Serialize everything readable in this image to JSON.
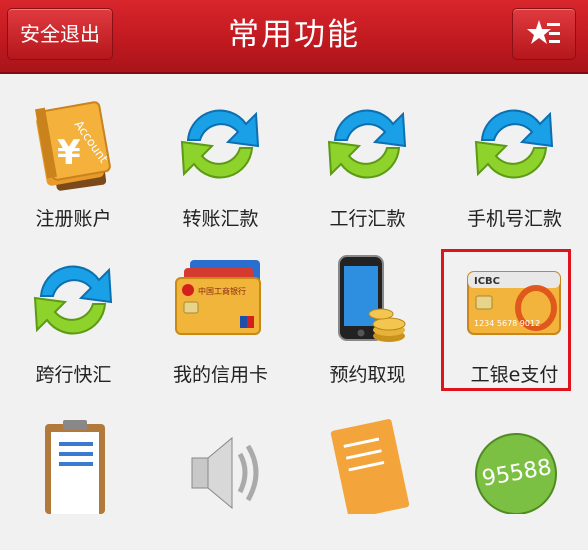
{
  "header": {
    "logout_label": "安全退出",
    "title": "常用功能",
    "menu_icon": "star-list-icon"
  },
  "grid": [
    {
      "label": "注册账户",
      "icon": "account-book-icon"
    },
    {
      "label": "转账汇款",
      "icon": "refresh-arrows-icon"
    },
    {
      "label": "工行汇款",
      "icon": "refresh-arrows-icon"
    },
    {
      "label": "手机号汇款",
      "icon": "refresh-arrows-icon"
    },
    {
      "label": "跨行快汇",
      "icon": "refresh-arrows-icon"
    },
    {
      "label": "我的信用卡",
      "icon": "credit-cards-icon"
    },
    {
      "label": "预约取现",
      "icon": "phone-coins-icon"
    },
    {
      "label": "工银e支付",
      "icon": "icbc-card-icon"
    },
    {
      "label": "",
      "icon": "clipboard-checklist-icon"
    },
    {
      "label": "",
      "icon": "speaker-icon"
    },
    {
      "label": "",
      "icon": "notepad-icon"
    },
    {
      "label": "",
      "icon": "hotline-95588-icon"
    }
  ],
  "icon_texts": {
    "account": "Account",
    "icbc": "ICBC",
    "card_number": "1234 5678 9012",
    "bank_card": "中国工商银行",
    "hotline": "95588"
  },
  "colors": {
    "header_red": "#c11a20",
    "highlight_border": "#e0121a",
    "background": "#f1f1f1"
  }
}
